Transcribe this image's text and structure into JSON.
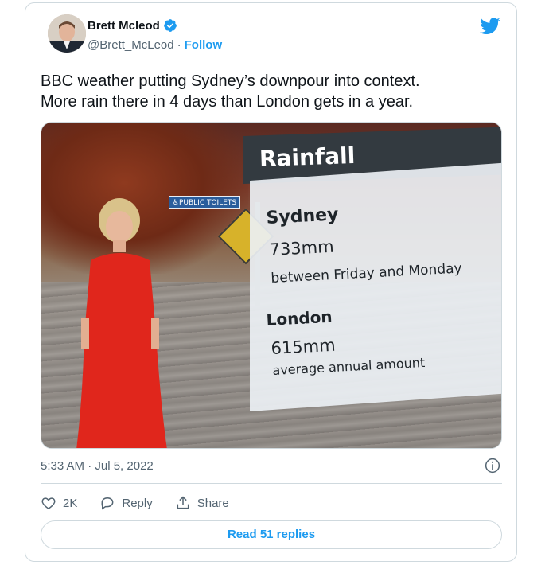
{
  "author": {
    "name": "Brett Mcleod",
    "handle": "@Brett_McLeod",
    "separator": "·",
    "follow_label": "Follow"
  },
  "tweet": {
    "text": "BBC weather putting Sydney’s downpour into context.\nMore rain there in 4 days than London gets in a year."
  },
  "media": {
    "street_sign_text": "♿PUBLIC TOILETS",
    "graphic": {
      "title": "Rainfall",
      "sydney_label": "Sydney",
      "sydney_value": "733mm",
      "sydney_note": "between Friday and Monday",
      "london_label": "London",
      "london_value": "615mm",
      "london_note": "average annual amount"
    }
  },
  "meta": {
    "timestamp": "5:33 AM · Jul 5, 2022"
  },
  "actions": {
    "like_count": "2K",
    "reply_label": "Reply",
    "share_label": "Share"
  },
  "read_replies_label": "Read 51 replies",
  "colors": {
    "accent": "#1d9bf0",
    "text": "#0f1419",
    "secondary": "#536471",
    "border": "#cfd9de"
  },
  "icons": [
    "verified-badge-icon",
    "twitter-bird-icon",
    "info-icon",
    "heart-icon",
    "reply-bubble-icon",
    "share-icon"
  ]
}
